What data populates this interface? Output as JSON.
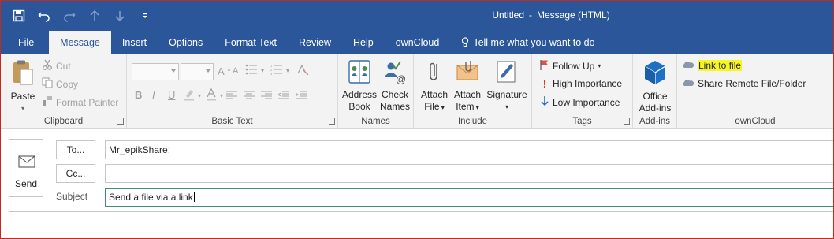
{
  "window": {
    "title_doc": "Untitled",
    "title_sep": "-",
    "title_type": "Message (HTML)"
  },
  "qat": [
    "save-icon",
    "undo-icon",
    "redo-icon",
    "up-arrow-icon",
    "down-arrow-icon",
    "customize-icon"
  ],
  "tabs": [
    {
      "label": "File"
    },
    {
      "label": "Message"
    },
    {
      "label": "Insert"
    },
    {
      "label": "Options"
    },
    {
      "label": "Format Text"
    },
    {
      "label": "Review"
    },
    {
      "label": "Help"
    },
    {
      "label": "ownCloud"
    },
    {
      "label": "Tell me what you want to do"
    }
  ],
  "ribbon": {
    "clipboard": {
      "label": "Clipboard",
      "paste": "Paste",
      "cut": "Cut",
      "copy": "Copy",
      "format_painter": "Format Painter"
    },
    "basic_text": {
      "label": "Basic Text",
      "bold": "B",
      "italic": "I",
      "underline": "U",
      "grow": "A",
      "shrink": "A"
    },
    "names": {
      "label": "Names",
      "address_book_1": "Address",
      "address_book_2": "Book",
      "check_names_1": "Check",
      "check_names_2": "Names"
    },
    "include": {
      "label": "Include",
      "attach_file_1": "Attach",
      "attach_file_2": "File",
      "attach_item_1": "Attach",
      "attach_item_2": "Item",
      "signature": "Signature"
    },
    "tags": {
      "label": "Tags",
      "follow_up": "Follow Up",
      "high": "High Importance",
      "low": "Low Importance"
    },
    "addins": {
      "label": "Add-ins",
      "office_1": "Office",
      "office_2": "Add-ins"
    },
    "owncloud": {
      "label": "ownCloud",
      "link_to_file": "Link to file",
      "share_remote": "Share Remote File/Folder"
    }
  },
  "compose": {
    "send": "Send",
    "to_button": "To...",
    "cc_button": "Cc...",
    "subject_label": "Subject",
    "to_value": "Mr_epikShare;",
    "cc_value": "",
    "subject_value": "Send a file via a link"
  },
  "colors": {
    "brand": "#2b579a",
    "highlight": "#f7f71d",
    "office_blue": "#1f6fc5"
  }
}
